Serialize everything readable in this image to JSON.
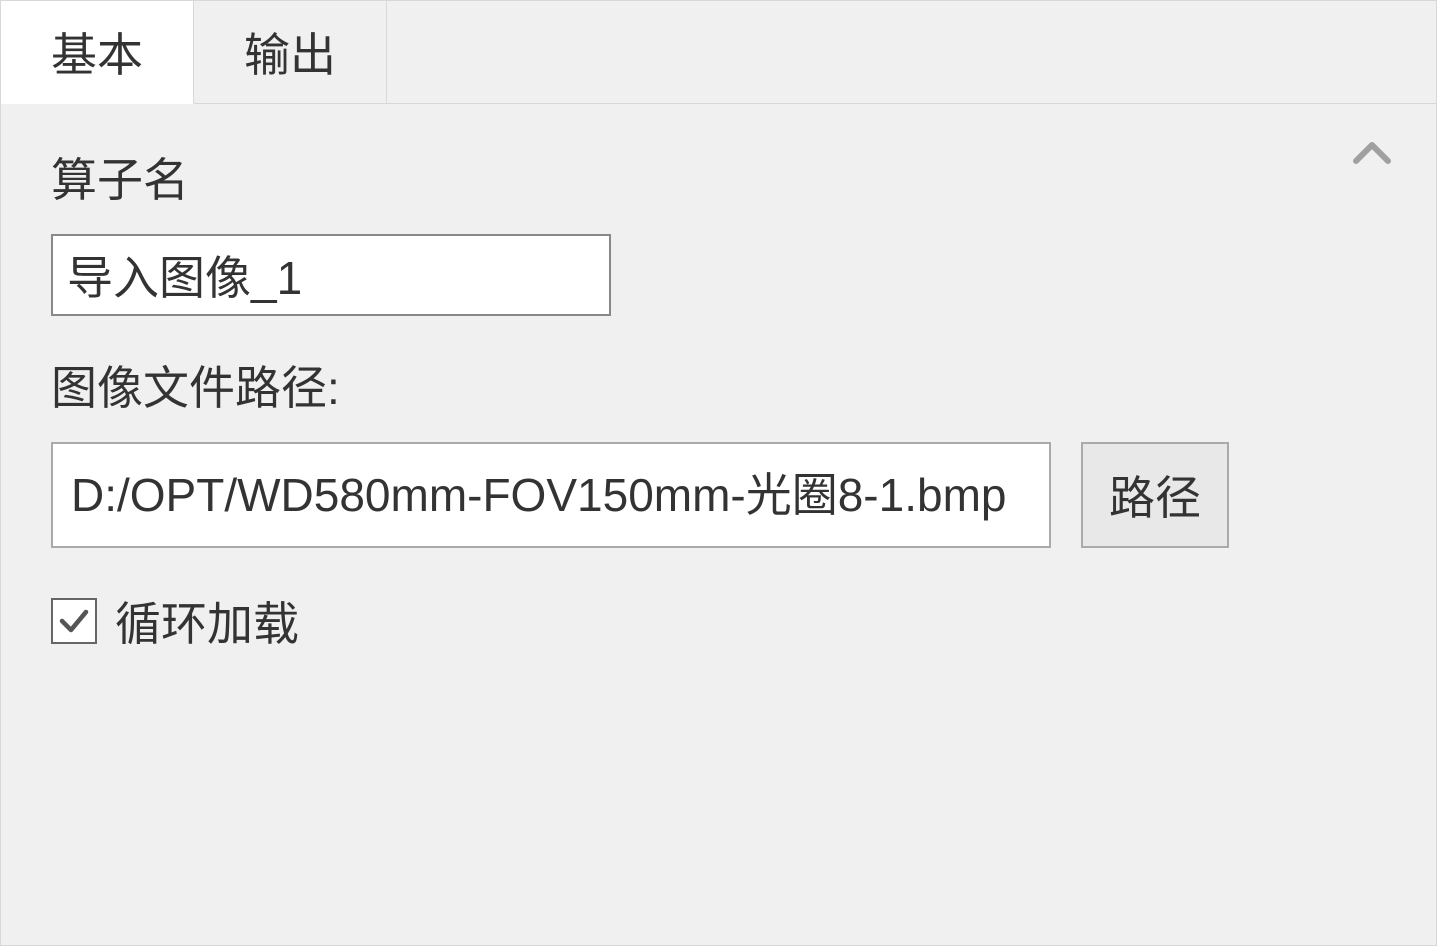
{
  "tabs": {
    "basic": "基本",
    "output": "输出"
  },
  "content": {
    "operator_name_label": "算子名",
    "operator_name_value": "导入图像_1",
    "image_path_label": "图像文件路径:",
    "image_path_value": "D:/OPT/WD580mm-FOV150mm-光圈8-1.bmp",
    "path_button_label": "路径",
    "loop_load_label": "循环加载",
    "loop_load_checked": true
  }
}
